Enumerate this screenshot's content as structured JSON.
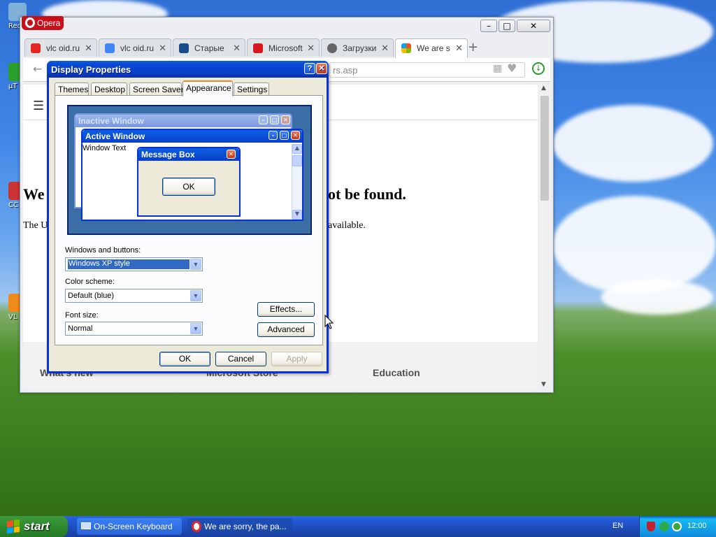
{
  "desktop": {
    "icon_labels": [
      "Rec",
      "μT",
      "CC",
      "VL"
    ]
  },
  "opera": {
    "menu_label": "Opera",
    "window_controls": [
      "–",
      "□",
      "✕"
    ],
    "tabs": [
      {
        "label": "vlc oid.ru",
        "favicon_color": "#e52620"
      },
      {
        "label": "vlc oid.ru",
        "favicon_color": "#4285f4"
      },
      {
        "label": "Старые",
        "favicon_color": "#1a4c8c"
      },
      {
        "label": "Microsoft",
        "favicon_color": "#d7171f"
      },
      {
        "label": "Загрузки",
        "favicon_color": "#666666"
      },
      {
        "label": "We are s",
        "favicon_color": "#f25022"
      }
    ],
    "address_visible": "rs.asp",
    "page_heading_left": "We",
    "page_heading_right": "ot be found.",
    "page_text_left": "The U",
    "page_text_right": "available.",
    "footer_links": [
      "What's new",
      "Microsoft Store",
      "Education"
    ]
  },
  "dialog": {
    "title": "Display Properties",
    "help_button": "?",
    "close_button": "✕",
    "tabs": [
      "Themes",
      "Desktop",
      "Screen Saver",
      "Appearance",
      "Settings"
    ],
    "active_tab": "Appearance",
    "preview": {
      "inactive_title": "Inactive Window",
      "active_title": "Active Window",
      "window_text": "Window Text",
      "message_title": "Message Box",
      "message_ok": "OK"
    },
    "windows_buttons_label": "Windows and buttons:",
    "windows_buttons_value": "Windows XP style",
    "color_scheme_label": "Color scheme:",
    "color_scheme_value": "Default (blue)",
    "font_size_label": "Font size:",
    "font_size_value": "Normal",
    "effects_button": "Effects...",
    "advanced_button": "Advanced",
    "ok_button": "OK",
    "cancel_button": "Cancel",
    "apply_button": "Apply"
  },
  "taskbar": {
    "start_label": "start",
    "items": [
      "On-Screen Keyboard",
      "We are sorry, the pa..."
    ],
    "language": "EN",
    "clock": "12:00"
  },
  "colors": {
    "xp_title_blue": "#0a49d6",
    "start_green": "#2e8b2e",
    "dialog_bg": "#ece9d8"
  }
}
